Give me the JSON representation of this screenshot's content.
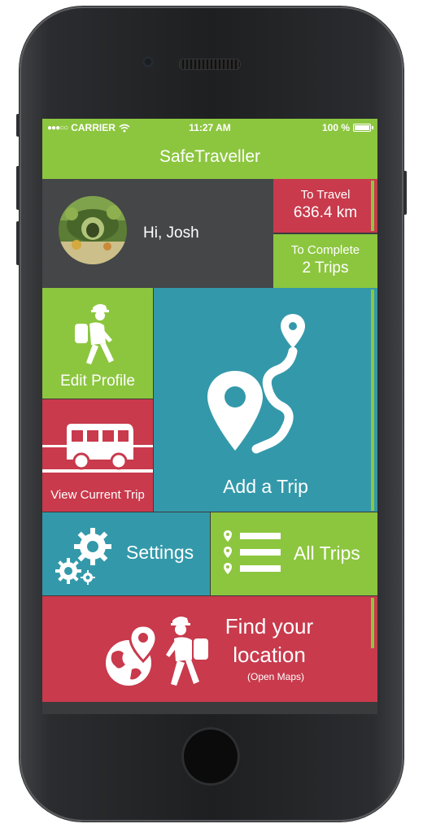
{
  "status_bar": {
    "signal": "●●●○○",
    "carrier": "CARRIER",
    "time": "11:27 AM",
    "battery_text": "100 %",
    "battery_level": 1.0
  },
  "app": {
    "title": "SafeTraveller"
  },
  "greeting": {
    "text": "Hi, Josh"
  },
  "stats": {
    "to_travel_label": "To Travel",
    "to_travel_value": "636.4 km",
    "to_complete_label": "To Complete",
    "to_complete_value": "2 Trips"
  },
  "tiles": {
    "edit_profile": "Edit Profile",
    "view_current_trip": "View Current Trip",
    "add_trip": "Add a Trip",
    "settings": "Settings",
    "all_trips": "All Trips",
    "find_location_line1": "Find your",
    "find_location_line2": "location",
    "find_location_sub": "(Open Maps)"
  },
  "icons": [
    "wifi-icon",
    "battery-icon",
    "avatar",
    "hiker-icon",
    "bus-icon",
    "route-pin-icon",
    "gears-icon",
    "list-pins-icon",
    "globe-pin-icon",
    "traveller-icon"
  ],
  "colors": {
    "green": "#8cc63f",
    "red": "#c83a4c",
    "teal": "#3399aa",
    "dark": "#454648"
  }
}
